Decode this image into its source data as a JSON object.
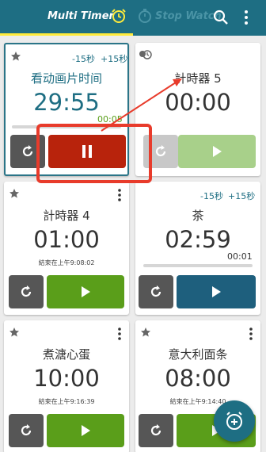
{
  "appbar": {
    "multi_timer_tab": "Multi Timer",
    "stop_watch_tab": "Stop Watch",
    "colors": {
      "bar": "#1e6e83",
      "indicator": "#ffeb3b"
    }
  },
  "timers": [
    {
      "name": "看动画片时间",
      "time": "29:55",
      "minus": "-15秒",
      "plus": "+15秒",
      "elapsed": "00:05",
      "progress": 0.003,
      "state": "running"
    },
    {
      "name": "計時器 5",
      "time": "00:00",
      "state": "idle"
    },
    {
      "name": "計時器 4",
      "time": "01:00",
      "end": "結束在上午9:08:02",
      "state": "ready"
    },
    {
      "name": "茶",
      "time": "02:59",
      "minus": "-15秒",
      "plus": "+15秒",
      "elapsed": "00:01",
      "progress": 0.006,
      "state": "ready"
    },
    {
      "name": "煮溏心蛋",
      "time": "10:00",
      "end": "結束在上午9:16:39",
      "state": "ready"
    },
    {
      "name": "意大利面条",
      "time": "08:00",
      "end": "結束在上午9:14:40",
      "state": "ready"
    }
  ]
}
